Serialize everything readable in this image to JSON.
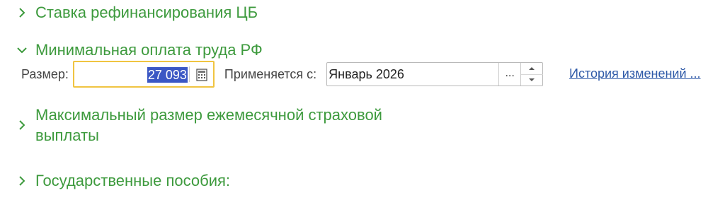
{
  "sections": {
    "refinancing": {
      "title": "Ставка рефинансирования ЦБ",
      "expanded": false,
      "icon": "chevron-right-icon"
    },
    "minimum_wage": {
      "title": "Минимальная оплата труда РФ",
      "expanded": true,
      "icon": "chevron-down-icon"
    },
    "max_insurance": {
      "title_line1": "Максимальный размер ежемесячной страховой",
      "title_line2": "выплаты",
      "expanded": false,
      "icon": "chevron-right-icon"
    },
    "state_benefits": {
      "title": "Государственные пособия:",
      "expanded": false,
      "icon": "chevron-right-icon"
    }
  },
  "minimum_wage_row": {
    "size_label": "Размер:",
    "size_value": "27 093",
    "calc_icon": "calculator-icon",
    "applies_label": "Применяется с:",
    "period_value": "Январь 2026",
    "select_button": "...",
    "history_link": "История изменений ..."
  },
  "colors": {
    "section_title": "#3d9a3d",
    "focus_border": "#f0c441",
    "selection": "#3b57c4",
    "link": "#2f5aa8"
  }
}
